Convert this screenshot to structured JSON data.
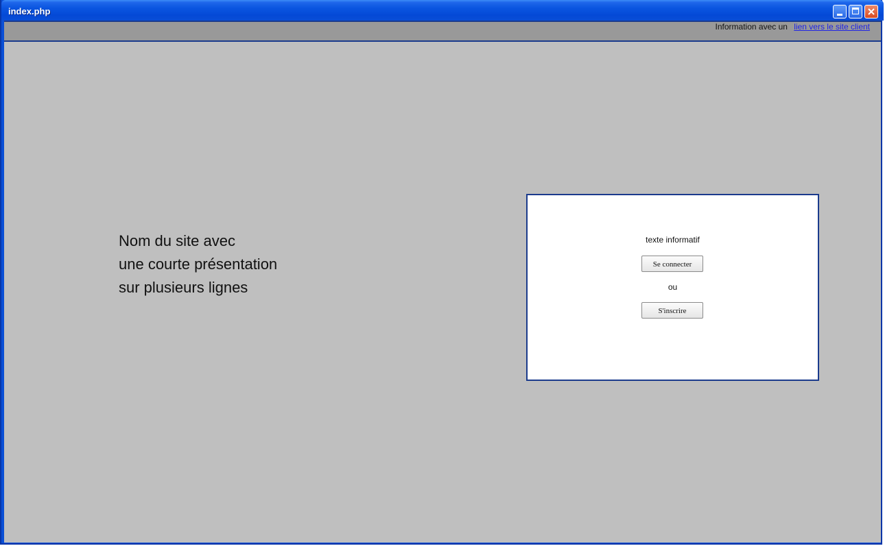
{
  "window": {
    "title": "index.php"
  },
  "topbar": {
    "info_text": "Information avec un",
    "link_text": "lien vers le site client"
  },
  "presentation": {
    "lines": [
      "Nom du site avec",
      "une courte présentation",
      "sur plusieurs lignes"
    ]
  },
  "card": {
    "info_text": "texte informatif",
    "login_label": "Se connecter",
    "or_text": "ou",
    "signup_label": "S'inscrire"
  },
  "colors": {
    "titlebar": "#0a55e0",
    "background": "#bfbfbf",
    "topbar": "#999999",
    "border_accent": "#1a3a8c",
    "link": "#1f23e6",
    "close_button": "#d94b23"
  },
  "icons": {
    "minimize": "minimize-icon",
    "maximize": "maximize-icon",
    "close": "close-icon"
  }
}
